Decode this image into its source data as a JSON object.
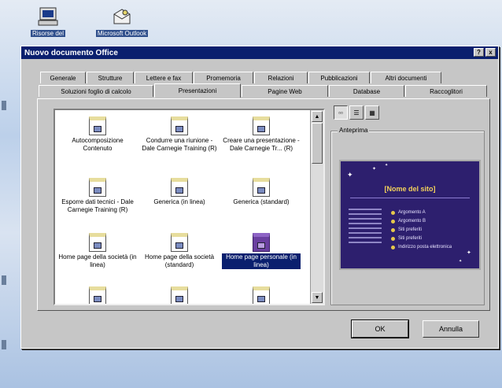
{
  "desktop": {
    "icons": [
      {
        "name": "computer-icon",
        "label": "Risorse del"
      },
      {
        "name": "outlook-icon",
        "label": "Microsoft Outlook"
      }
    ]
  },
  "dialog": {
    "title": "Nuovo documento Office",
    "help_button": "?",
    "close_button": "x",
    "tabs_back": [
      "Generale",
      "Strutture",
      "Lettere e fax",
      "Promemoria",
      "Relazioni",
      "Pubblicazioni",
      "Altri documenti"
    ],
    "tabs_front": [
      "Soluzioni foglio di calcolo",
      "Presentazioni",
      "Pagine Web",
      "Database",
      "Raccoglitori"
    ],
    "active_tab": "Presentazioni",
    "items": [
      "Autocomposizione Contenuto",
      "Condurre una riunione - Dale Carnegie Training (R)",
      "Creare una presentazione - Dale Carnegie Tr... (R)",
      "Esporre dati tecnici - Dale Carnegie Training (R)",
      "Generica (in linea)",
      "Generica (standard)",
      "Home page della società (in linea)",
      "Home page della società (standard)",
      "Home page personale (in linea)",
      "",
      "",
      ""
    ],
    "selected_item": "Home page personale (in linea)",
    "view_buttons": [
      "large-icons",
      "list",
      "details"
    ],
    "preview_label": "Anteprima",
    "preview": {
      "slide_title": "[Nome del sito]",
      "bullets": [
        "Argomento A",
        "Argomento B",
        "Siti preferiti",
        "Siti preferiti",
        "Indirizzo posta elettronica"
      ]
    },
    "ok_label": "OK",
    "cancel_label": "Annulla"
  },
  "colors": {
    "titlebar": "#0a1f6e",
    "dialog_bg": "#c6c6c6",
    "slide_bg": "#2d1f6e",
    "slide_title": "#f3d25b"
  }
}
